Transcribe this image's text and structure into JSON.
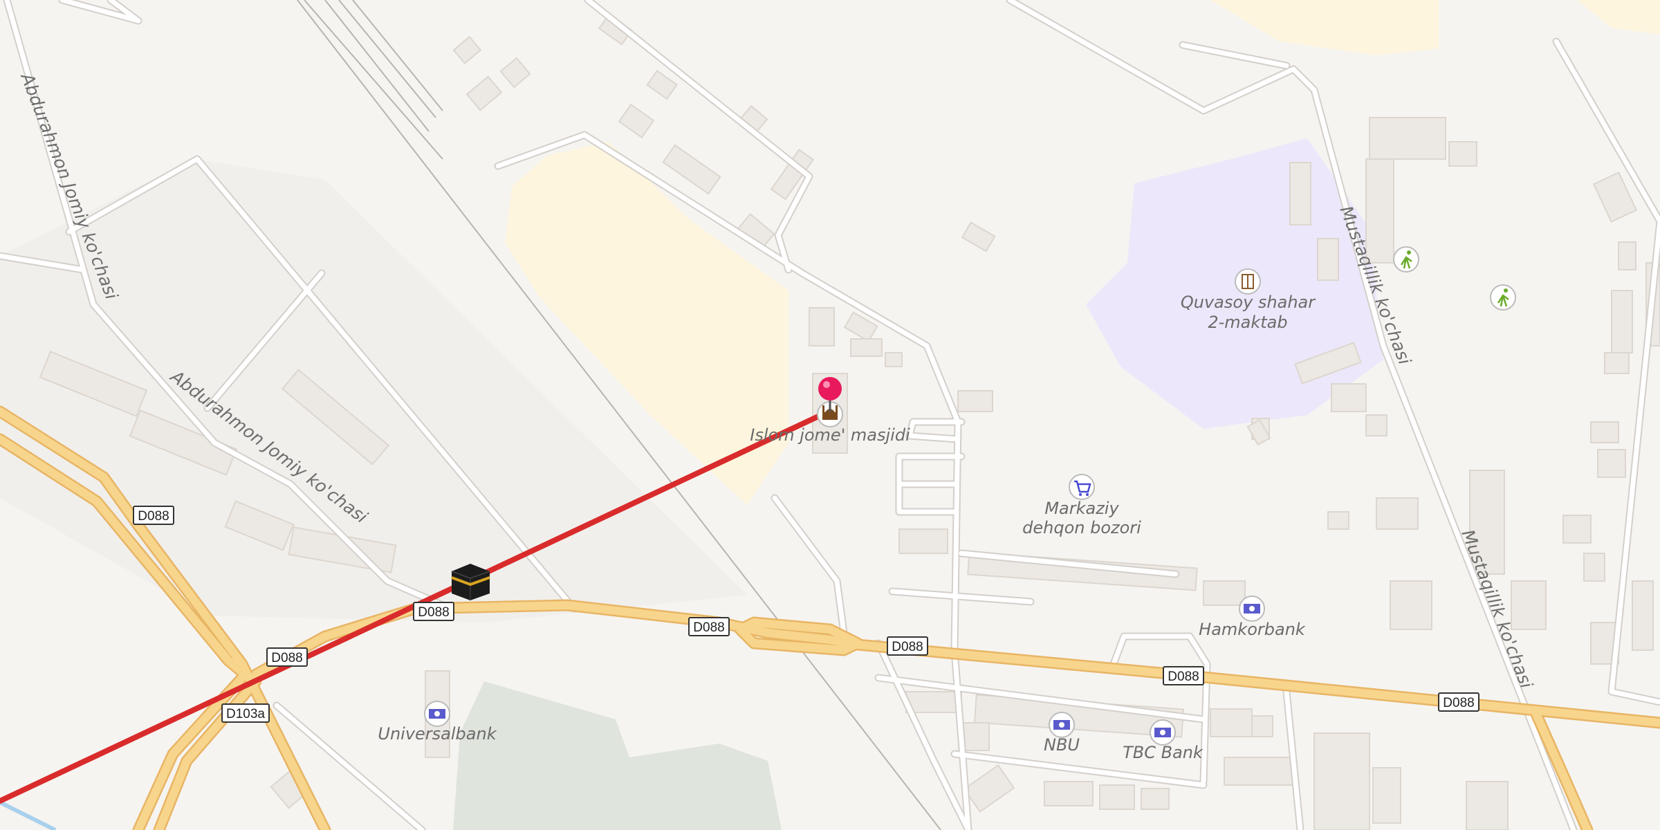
{
  "map": {
    "streets": {
      "jomiy_upper": "Abdurahmon Jomiy ko'chasi",
      "jomiy_lower": "Abdurahmon Jomiy ko'chasi",
      "mustaqillik_upper": "Mustaqillik ko'chasi",
      "mustaqillik_lower": "Mustaqillik ko'chasi"
    },
    "shields": [
      "D088",
      "D088",
      "D088",
      "D088",
      "D088",
      "D088",
      "D088",
      "D103a"
    ],
    "pois": {
      "mosque": "Islom jome' masjidi",
      "school_line1": "Quvasoy shahar",
      "school_line2": "2-maktab",
      "market_line1": "Markaziy",
      "market_line2": "dehqon bozori",
      "hamkorbank": "Hamkorbank",
      "universalbank": "Universalbank",
      "nbu": "NBU",
      "tbc": "TBC Bank"
    },
    "icons": {
      "pin": "location-pin-icon",
      "kaaba": "kaaba-icon",
      "mosque": "mosque-icon",
      "school": "school-icon",
      "market": "shopping-cart-icon",
      "bank": "bank-note-icon",
      "sport": "running-person-icon"
    },
    "colors": {
      "qibla_line": "#d92b2b",
      "pin": "#e8195c",
      "road_primary": "#f7d58c",
      "school_area": "#ece7fa",
      "park_area": "#dfe4dc"
    }
  }
}
